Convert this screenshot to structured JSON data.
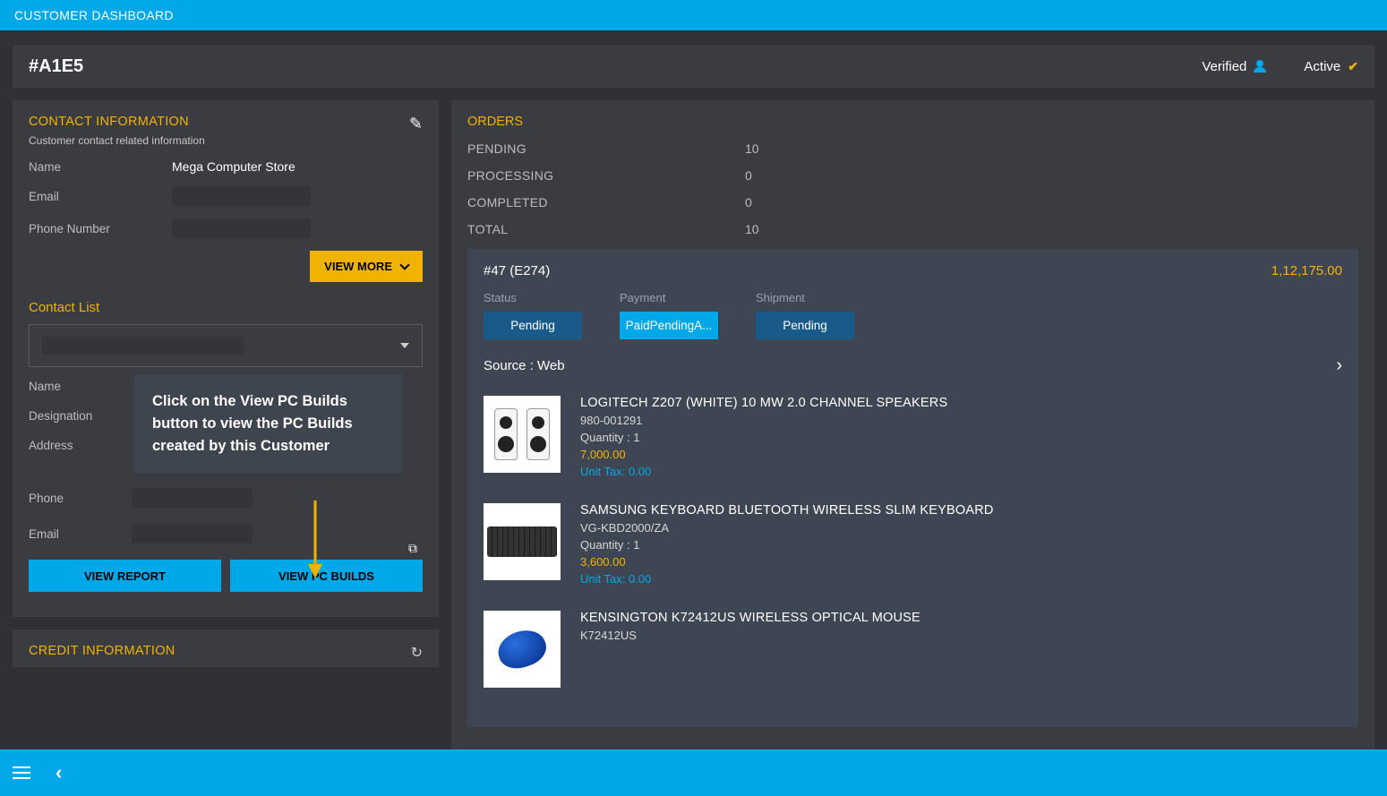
{
  "topbar": {
    "title": "CUSTOMER DASHBOARD"
  },
  "header": {
    "id": "#A1E5",
    "verified_label": "Verified",
    "active_label": "Active"
  },
  "contact": {
    "title": "CONTACT INFORMATION",
    "subtitle": "Customer contact related information",
    "name_label": "Name",
    "name_value": "Mega Computer Store",
    "email_label": "Email",
    "phone_label": "Phone Number",
    "view_more": "VIEW MORE"
  },
  "contact_list": {
    "title": "Contact List",
    "fields": {
      "name": "Name",
      "designation": "Designation",
      "address": "Address",
      "phone": "Phone",
      "email": "Email"
    },
    "view_report": "VIEW REPORT",
    "view_pc_builds": "VIEW PC BUILDS"
  },
  "tooltip": {
    "text": "Click on the View PC Builds button to view the PC Builds created by this Customer"
  },
  "credit": {
    "title": "CREDIT INFORMATION"
  },
  "orders": {
    "title": "ORDERS",
    "stats": {
      "pending_label": "PENDING",
      "pending_val": "10",
      "processing_label": "PROCESSING",
      "processing_val": "0",
      "completed_label": "COMPLETED",
      "completed_val": "0",
      "total_label": "TOTAL",
      "total_val": "10"
    },
    "order": {
      "id": "#47 (E274)",
      "amount": "1,12,175.00",
      "status_label": "Status",
      "status_val": "Pending",
      "payment_label": "Payment",
      "payment_val": "PaidPendingA...",
      "shipment_label": "Shipment",
      "shipment_val": "Pending",
      "source": "Source : Web"
    },
    "products": [
      {
        "name": "LOGITECH Z207 (WHITE) 10 MW 2.0 CHANNEL SPEAKERS",
        "sku": "980-001291",
        "qty": "Quantity : 1",
        "price": "7,000.00",
        "tax": "Unit Tax: 0.00",
        "img": "speakers"
      },
      {
        "name": "SAMSUNG KEYBOARD BLUETOOTH WIRELESS SLIM KEYBOARD",
        "sku": "VG-KBD2000/ZA",
        "qty": "Quantity : 1",
        "price": "3,600.00",
        "tax": "Unit Tax: 0.00",
        "img": "keyboard"
      },
      {
        "name": "KENSINGTON K72412US WIRELESS OPTICAL MOUSE",
        "sku": "K72412US",
        "qty": "",
        "price": "",
        "tax": "",
        "img": "mouse"
      }
    ]
  }
}
